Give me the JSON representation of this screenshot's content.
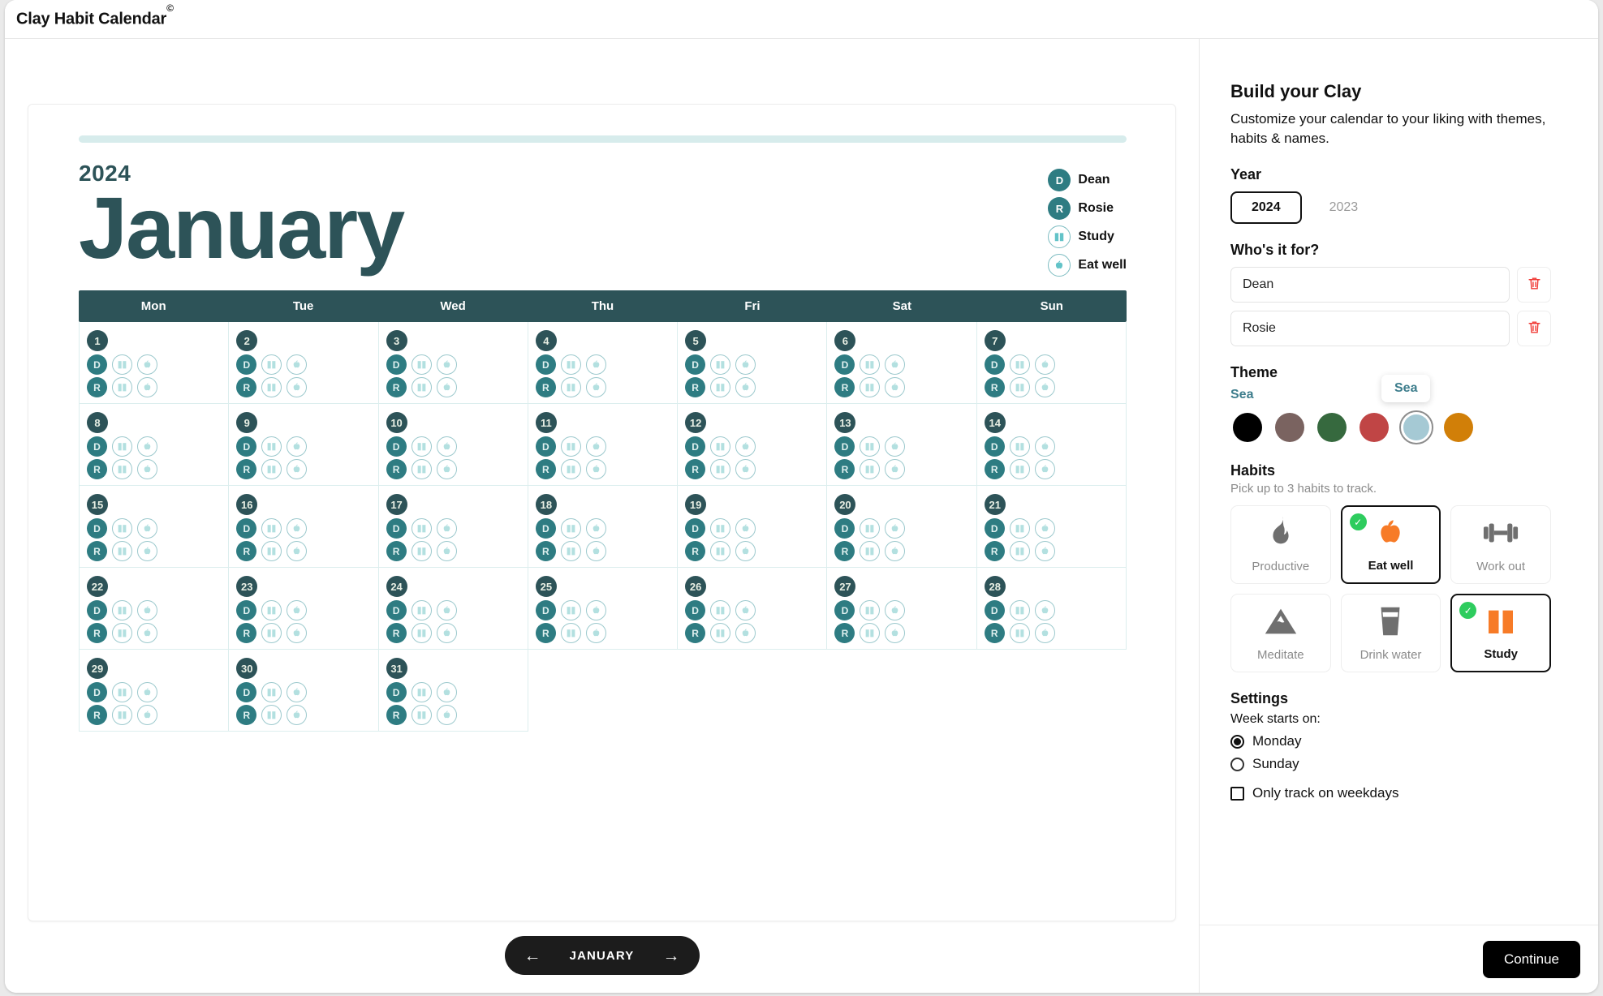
{
  "app": {
    "title": "Clay Habit Calendar",
    "title_mark": "©"
  },
  "calendar": {
    "year": "2024",
    "month": "January",
    "weekdays": [
      "Mon",
      "Tue",
      "Wed",
      "Thu",
      "Fri",
      "Sat",
      "Sun"
    ],
    "legend": [
      {
        "badge": "D",
        "label": "Dean",
        "kind": "person"
      },
      {
        "badge": "R",
        "label": "Rosie",
        "kind": "person"
      },
      {
        "badge": "book-icon",
        "label": "Study",
        "kind": "habit"
      },
      {
        "badge": "apple-icon",
        "label": "Eat well",
        "kind": "habit"
      }
    ],
    "people": [
      "D",
      "R"
    ],
    "tracked_habits": [
      "book-icon",
      "apple-icon"
    ],
    "weeks": [
      [
        "1",
        "2",
        "3",
        "4",
        "5",
        "6",
        "7"
      ],
      [
        "8",
        "9",
        "10",
        "11",
        "12",
        "13",
        "14"
      ],
      [
        "15",
        "16",
        "17",
        "18",
        "19",
        "20",
        "21"
      ],
      [
        "22",
        "23",
        "24",
        "25",
        "26",
        "27",
        "28"
      ],
      [
        "29",
        "30",
        "31",
        "",
        "",
        "",
        ""
      ]
    ],
    "nav": {
      "prev_icon": "arrow-left-icon",
      "label": "JANUARY",
      "next_icon": "arrow-right-icon"
    },
    "accent_color": "#d7ecec",
    "heading_color": "#2d5358"
  },
  "panel": {
    "heading": "Build your Clay",
    "subheading": "Customize your calendar to your liking with themes, habits & names.",
    "year": {
      "label": "Year",
      "options": [
        {
          "value": "2024",
          "selected": true
        },
        {
          "value": "2023",
          "selected": false
        }
      ]
    },
    "people": {
      "label": "Who's it for?",
      "entries": [
        {
          "value": "Dean",
          "delete_icon": "trash-icon"
        },
        {
          "value": "Rosie",
          "delete_icon": "trash-icon"
        }
      ]
    },
    "theme": {
      "label": "Theme",
      "selected_name": "Sea",
      "tooltip": "Sea",
      "swatches": [
        {
          "name": "Ink",
          "color": "#000000",
          "selected": false
        },
        {
          "name": "Clay",
          "color": "#7a6360",
          "selected": false
        },
        {
          "name": "Forest",
          "color": "#36693e",
          "selected": false
        },
        {
          "name": "Berry",
          "color": "#c04545",
          "selected": false
        },
        {
          "name": "Sea",
          "color": "#a5c9d4",
          "selected": true
        },
        {
          "name": "Amber",
          "color": "#d17f08",
          "selected": false
        }
      ]
    },
    "habits": {
      "label": "Habits",
      "note": "Pick up to 3 habits to track.",
      "items": [
        {
          "label": "Productive",
          "icon": "flame-icon",
          "selected": false
        },
        {
          "label": "Eat well",
          "icon": "apple-icon",
          "selected": true
        },
        {
          "label": "Work out",
          "icon": "dumbbell-icon",
          "selected": false
        },
        {
          "label": "Meditate",
          "icon": "mountain-icon",
          "selected": false
        },
        {
          "label": "Drink water",
          "icon": "glass-icon",
          "selected": false
        },
        {
          "label": "Study",
          "icon": "book-icon",
          "selected": true
        }
      ]
    },
    "settings": {
      "label": "Settings",
      "week_start_label": "Week starts on:",
      "week_start_options": [
        {
          "label": "Monday",
          "selected": true
        },
        {
          "label": "Sunday",
          "selected": false
        }
      ],
      "weekdays_only": {
        "label": "Only track on weekdays",
        "checked": false
      }
    },
    "continue_label": "Continue"
  }
}
